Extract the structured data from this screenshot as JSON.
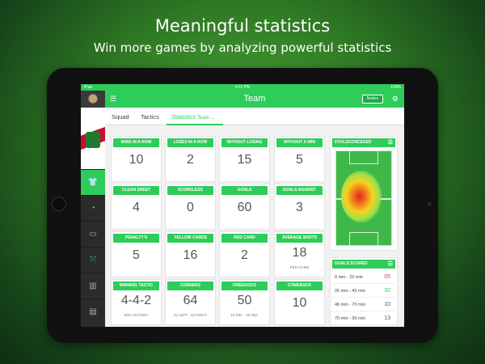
{
  "hero": {
    "title": "Meaningful statistics",
    "subtitle": "Win more games by analyzing powerful statistics"
  },
  "status_bar": {
    "carrier": "iPad",
    "time": "4:21 PM",
    "battery": "100%"
  },
  "header": {
    "title": "Team",
    "notes_label": "Notes"
  },
  "tabs": {
    "squad": "Squad",
    "tactics": "Tactics",
    "statistics": "Statistics",
    "statistics_sub": "Team"
  },
  "stats": [
    {
      "label": "WINS IN A ROW",
      "value": "10",
      "sub": ""
    },
    {
      "label": "LOSES IN A ROW",
      "value": "2",
      "sub": ""
    },
    {
      "label": "WITHOUT LOSING",
      "value": "15",
      "sub": ""
    },
    {
      "label": "WITHOUT A WIN",
      "value": "5",
      "sub": ""
    },
    {
      "label": "CLEAN SHEET",
      "value": "4",
      "sub": ""
    },
    {
      "label": "SCORELESS",
      "value": "0",
      "sub": ""
    },
    {
      "label": "GOALS",
      "value": "60",
      "sub": ""
    },
    {
      "label": "GOALS AGAINST",
      "value": "3",
      "sub": ""
    },
    {
      "label": "PENALTY'S",
      "value": "5",
      "sub": ""
    },
    {
      "label": "YELLOW CARDS",
      "value": "16",
      "sub": ""
    },
    {
      "label": "RED CARD",
      "value": "2",
      "sub": ""
    },
    {
      "label": "AVERAGE SHOTS",
      "value": "18",
      "sub": "PER GAME"
    },
    {
      "label": "WINNING TACTIC",
      "value": "4-4-2",
      "sub": "80% VICTORY"
    },
    {
      "label": "CORNERS",
      "value": "64",
      "sub": "22 LEFT - 42 RIGHT"
    },
    {
      "label": "FREEKICKS",
      "value": "50",
      "sub": "10 DIR. - 40 IND."
    },
    {
      "label": "COMEBACK",
      "value": "10",
      "sub": ""
    }
  ],
  "fouls_panel": {
    "title": "FOULSCONCEDED"
  },
  "goals_scored": {
    "title": "GOALS SCORED",
    "rows": [
      {
        "range": "0 min - 25 min",
        "value": "05",
        "color": "#e53935"
      },
      {
        "range": "26 min - 45 min",
        "value": "32",
        "color": "#2ecc5a"
      },
      {
        "range": "46 min - 70 min",
        "value": "10",
        "color": "#555555"
      },
      {
        "range": "70 min - 90 min",
        "value": "13",
        "color": "#555555"
      }
    ]
  },
  "colors": {
    "accent": "#2ecc5a",
    "sidebar": "#2b2b2b"
  }
}
